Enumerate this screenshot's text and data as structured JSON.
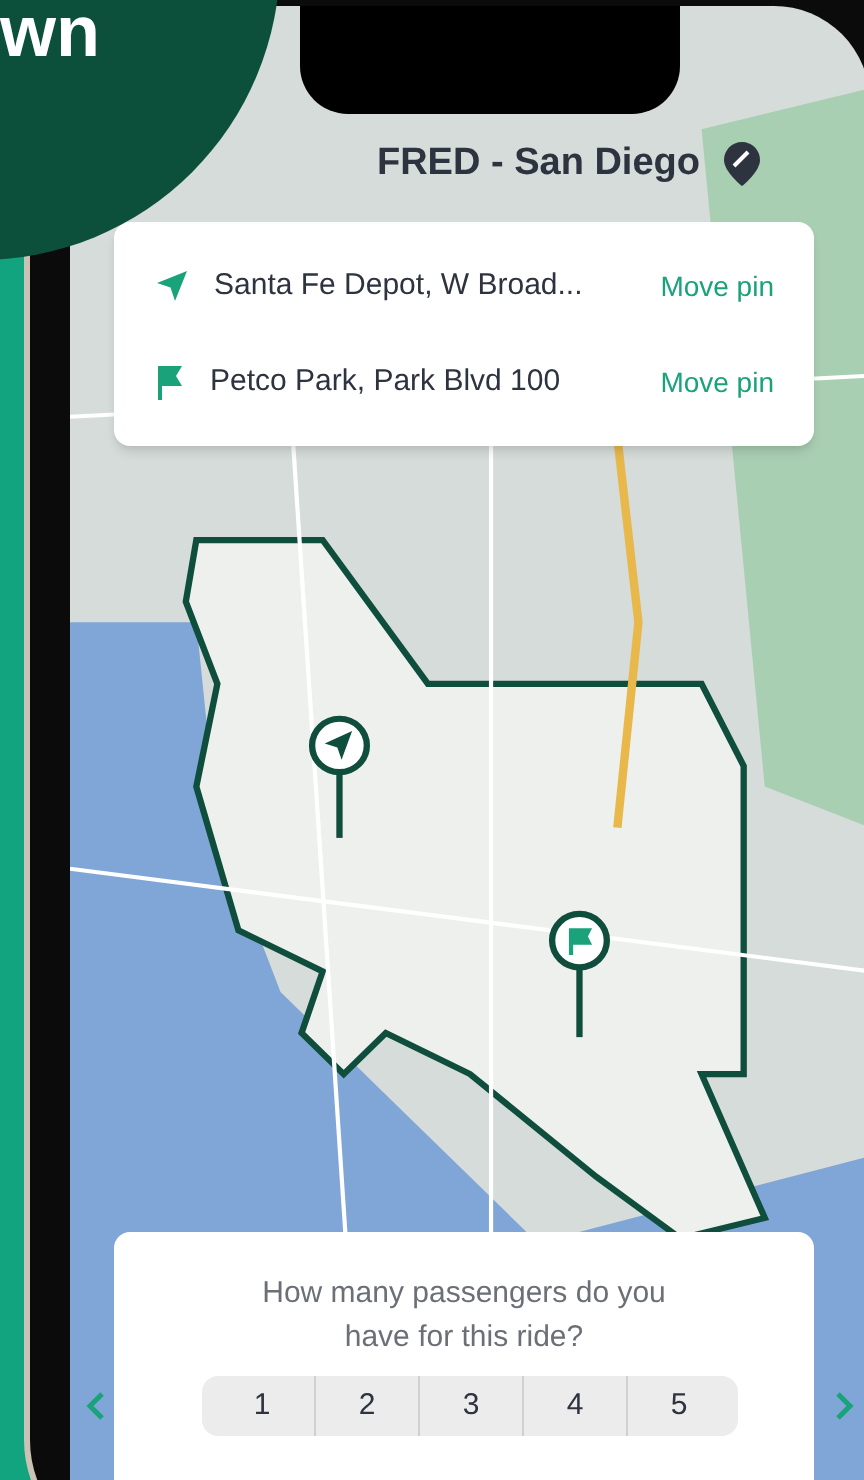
{
  "banner": {
    "text": "wn"
  },
  "header": {
    "title": "FRED - San Diego"
  },
  "route": [
    {
      "kind": "origin",
      "address": "Santa Fe Depot, W Broad...",
      "action": "Move pin"
    },
    {
      "kind": "destination",
      "address": "Petco Park, Park Blvd 100",
      "action": "Move pin"
    }
  ],
  "passengers": {
    "question": "How many passengers do you have for this ride?",
    "options": [
      "1",
      "2",
      "3",
      "4",
      "5"
    ]
  }
}
